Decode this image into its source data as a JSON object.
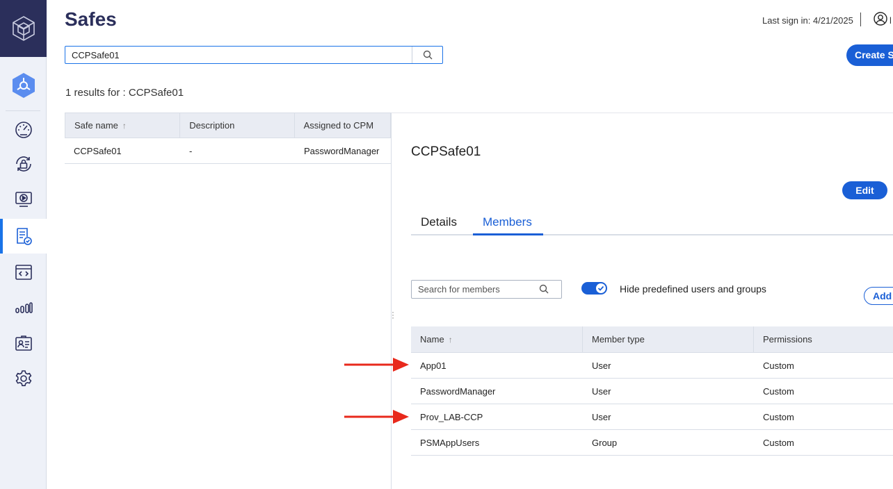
{
  "header": {
    "title": "Safes",
    "last_sign_in": "Last sign in: 4/21/2025",
    "user_name_cut": "l",
    "create_button": "Create Safe"
  },
  "search": {
    "value": "CCPSafe01"
  },
  "results": {
    "text": "1 results  for : CCPSafe01"
  },
  "safes_table": {
    "columns": [
      "Safe name",
      "Description",
      "Assigned to CPM"
    ],
    "sort_indicator": "↑",
    "rows": [
      [
        "CCPSafe01",
        "-",
        "PasswordManager"
      ]
    ]
  },
  "details_panel": {
    "title": "CCPSafe01",
    "edit_button": "Edit",
    "tabs": [
      {
        "label": "Details",
        "active": false
      },
      {
        "label": "Members",
        "active": true
      }
    ],
    "member_search_placeholder": "Search for members",
    "toggle_label": "Hide predefined users and groups",
    "toggle_on": true,
    "add_button": "Add member",
    "members_table": {
      "columns": [
        "Name",
        "Member type",
        "Permissions"
      ],
      "sort_indicator": "↑",
      "rows": [
        [
          "App01",
          "User",
          "Custom"
        ],
        [
          "PasswordManager",
          "User",
          "Custom"
        ],
        [
          "Prov_LAB-CCP",
          "User",
          "Custom"
        ],
        [
          "PSMAppUsers",
          "Group",
          "Custom"
        ]
      ]
    }
  },
  "sidebar": {
    "items": [
      {
        "icon": "dashboard-icon",
        "active": false
      },
      {
        "icon": "accounts-lock-icon",
        "active": false
      },
      {
        "icon": "monitoring-icon",
        "active": false
      },
      {
        "icon": "policies-icon",
        "active": true
      },
      {
        "icon": "applications-icon",
        "active": false
      },
      {
        "icon": "reports-icon",
        "active": false
      },
      {
        "icon": "users-icon",
        "active": false
      },
      {
        "icon": "settings-icon",
        "active": false
      }
    ]
  },
  "annotations": {
    "arrow_color": "#e8291c"
  },
  "colors": {
    "brand_dark": "#2b2f5b",
    "accent": "#1a5fd6"
  }
}
